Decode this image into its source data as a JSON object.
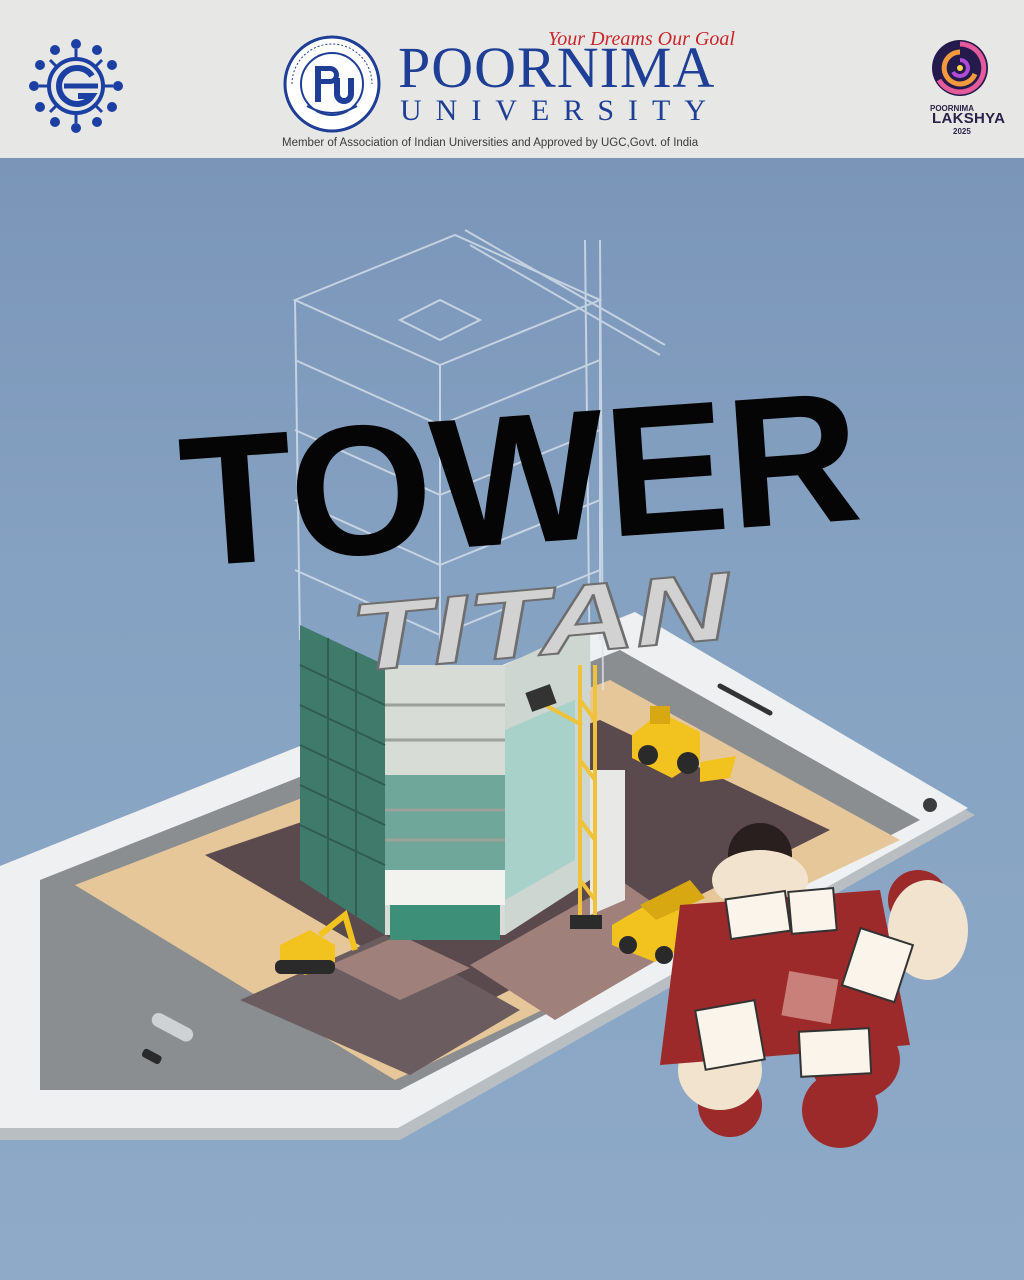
{
  "header": {
    "tagline": "Your Dreams Our Goal",
    "university_name": "POORNIMA",
    "university_sub": "UNIVERSITY",
    "member_line": "Member of Association of Indian Universities and Approved by UGC,Govt. of India",
    "seal_text": "POORNIMA UNIVERSITY",
    "seal_letters": "PU",
    "left_logo_icon": "gear-emblem-icon",
    "right_logo": {
      "name": "POORNIMA",
      "title": "LAKSHYA",
      "year": "2025"
    }
  },
  "title": {
    "main": "TOWER",
    "sub": "TITAN"
  },
  "colors": {
    "background": "#7f9cbd",
    "header_bg": "#e7e8e6",
    "brand_blue": "#1e3f95",
    "brand_red": "#c8262b",
    "title_black": "#050505",
    "subtitle_grey": "#d2d2d2",
    "table_red": "#9c2a2a"
  }
}
